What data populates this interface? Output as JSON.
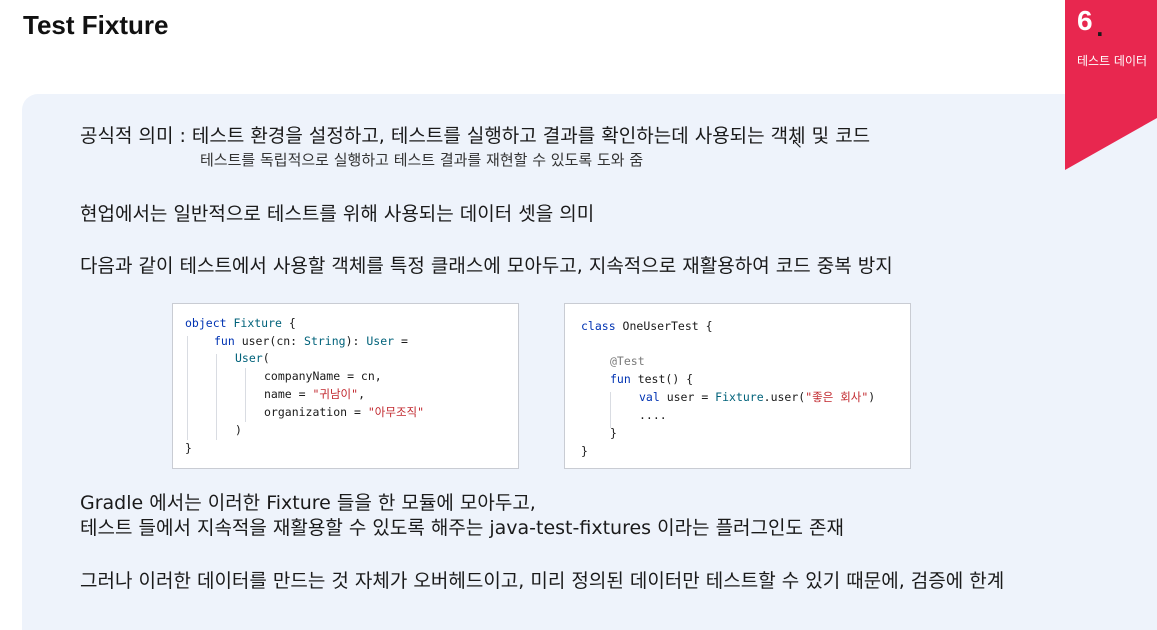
{
  "slide": {
    "title": "Test Fixture",
    "section_number": "6",
    "section_dot": ".",
    "section_label": "테스트 데이터"
  },
  "content": {
    "line1": "공식적 의미 : 테스트 환경을 설정하고, 테스트를 실행하고 결과를 확인하는데 사용되는 객체 및 코드",
    "line1_sub": "테스트를 독립적으로 실행하고 테스트 결과를 재현할 수 있도록 도와 줌",
    "line2": "현업에서는 일반적으로 테스트를 위해 사용되는 데이터 셋을 의미",
    "line3": "다음과 같이 테스트에서 사용할 객체를 특정 클래스에 모아두고, 지속적으로 재활용하여 코드 중복 방지",
    "line4a": "Gradle 에서는 이러한 Fixture 들을 한 모듈에 모아두고,",
    "line4b": "테스트 들에서 지속적을 재활용할 수 있도록 해주는 java-test-fixtures 이라는 플러그인도 존재",
    "line5": "그러나 이러한 데이터를 만드는 것 자체가 오버헤드이고, 미리 정의된 데이터만 테스트할 수 있기 때문에, 검증에 한계"
  },
  "code_fixture": {
    "kw_object": "object",
    "name": "Fixture",
    "open_brace": " {",
    "kw_fun": "fun",
    "fn_sig": " user(cn: ",
    "type_string": "String",
    "fn_sig2": "): ",
    "type_user": "User",
    "fn_eq": " =",
    "ctor": "User",
    "ctor_paren": "(",
    "arg1": "companyName = cn,",
    "arg2_key": "name = ",
    "arg2_val": "\"귀남이\"",
    "arg2_end": ",",
    "arg3_key": "organization = ",
    "arg3_val": "\"아무조직\"",
    "close_paren": ")",
    "close_brace": "}"
  },
  "code_test": {
    "kw_class": "class",
    "name": " OneUserTest {",
    "annotation": "@Test",
    "kw_fun": "fun",
    "fn": " test() {",
    "kw_val": "val",
    "assign": " user = ",
    "obj": "Fixture",
    "call": ".user(",
    "arg": "\"좋은 회사\"",
    "call_end": ")",
    "ellipsis": "....",
    "close_inner": "}",
    "close_outer": "}"
  },
  "colors": {
    "accent": "#e8274f",
    "panel": "#eef3fb",
    "keyword": "#0033b3",
    "type": "#00627a",
    "string": "#c1272d"
  }
}
